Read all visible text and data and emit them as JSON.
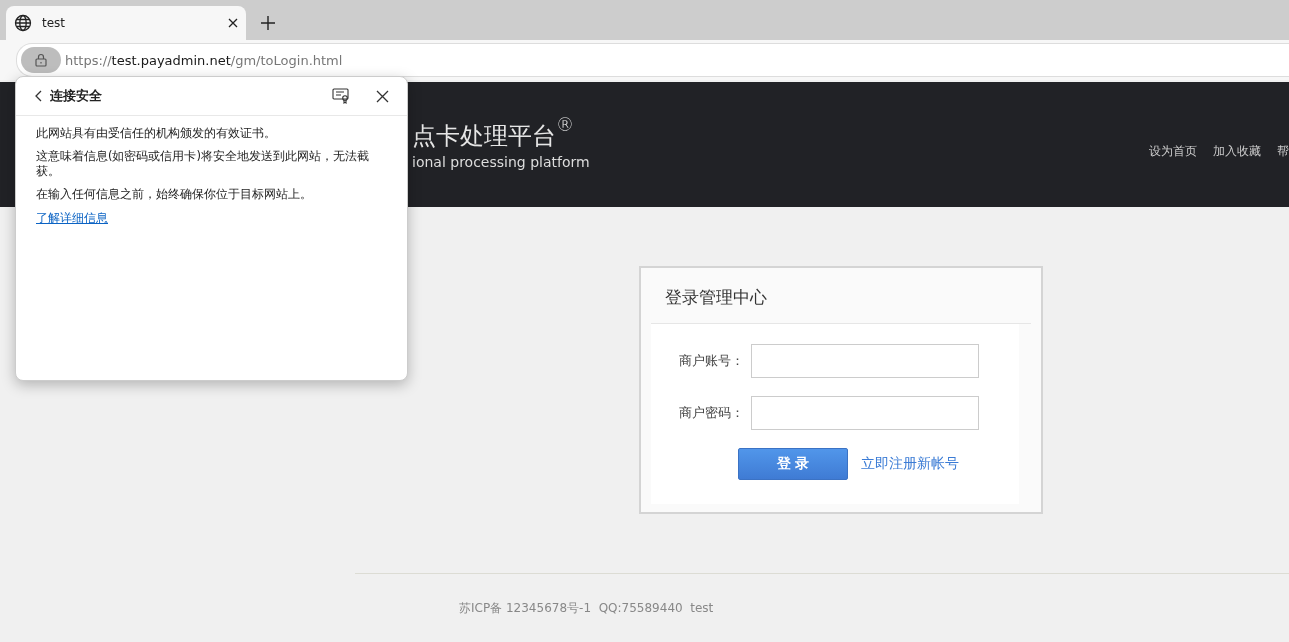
{
  "browser": {
    "tab": {
      "title": "test"
    },
    "url": {
      "scheme": "https://",
      "host": "test.payadmin.net",
      "path": "/gm/toLogin.html"
    }
  },
  "security_popup": {
    "title": "连接安全",
    "paragraphs": [
      "此网站具有由受信任的机构颁发的有效证书。",
      "这意味着信息(如密码或信用卡)将安全地发送到此网站，无法截获。",
      "在输入任何信息之前，始终确保你位于目标网站上。"
    ],
    "link": "了解详细信息"
  },
  "header": {
    "title": "点卡处理平台",
    "title_mark": "®",
    "subtitle": "ional processing platform",
    "nav": [
      "设为首页",
      "加入收藏",
      "帮"
    ]
  },
  "login": {
    "title": "登录管理中心",
    "fields": [
      {
        "label": "商户账号："
      },
      {
        "label": "商户密码："
      }
    ],
    "submit": "登 录",
    "register_link": "立即注册新帐号"
  },
  "footer": {
    "text": "苏ICP备 12345678号-1  QQ:75589440  test"
  }
}
